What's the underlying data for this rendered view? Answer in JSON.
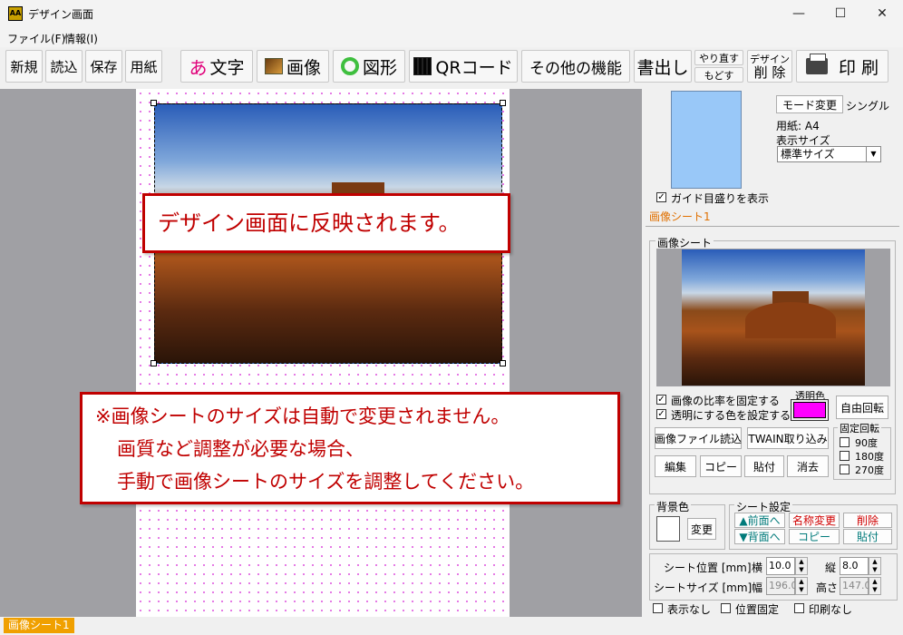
{
  "window": {
    "title": "デザイン画面",
    "app_icon": "AA",
    "minimize": "—",
    "maximize": "☐",
    "close": "✕"
  },
  "menu": {
    "file": "ファイル(F)",
    "info": "情報(I)"
  },
  "toolbar": {
    "new": "新規",
    "load": "読込",
    "save": "保存",
    "paper": "用紙",
    "text": "文字",
    "text_icon": "あ",
    "image": "画像",
    "shape": "図形",
    "qr": "QRコード",
    "other": "その他の機能",
    "export": "書出し",
    "redo": "やり直す",
    "undo": "もどす",
    "design_delete_top": "デザイン",
    "design_delete_bottom": "削 除",
    "print": "印 刷"
  },
  "callouts": {
    "reflect": "デザイン画面に反映されます。",
    "note_line1": "※画像シートのサイズは自動で変更されません。",
    "note_line2": "画質など調整が必要な場合、",
    "note_line3": "手動で画像シートのサイズを調整してください。"
  },
  "right": {
    "mode_change": "モード変更",
    "mode_value": "シングル",
    "paper_label": "用紙: A4",
    "display_size_label": "表示サイズ",
    "display_size_value": "標準サイズ",
    "show_guides": "ガイド目盛りを表示",
    "sheet_tab": "画像シート1",
    "sheet_group": "画像シート",
    "keep_ratio": "画像の比率を固定する",
    "set_transparent": "透明にする色を設定する",
    "transparent_color_label": "透明色",
    "transparent_color": "#ff00ff",
    "free_rotate": "自由回転",
    "load_image_file": "画像ファイル読込",
    "twain": "TWAIN取り込み",
    "edit": "編集",
    "copy": "コピー",
    "paste": "貼付",
    "erase": "消去",
    "fixed_rotate": "固定回転",
    "rot90": "90度",
    "rot180": "180度",
    "rot270": "270度",
    "bg_color": "背景色",
    "change": "変更",
    "sheet_settings": "シート設定",
    "front": "▲前面へ",
    "back": "▼背面へ",
    "rename": "名称変更",
    "delete": "削除",
    "copy2": "コピー",
    "paste2": "貼付",
    "sheet_pos": "シート位置 [mm]",
    "horizontal": "横",
    "vertical": "縦",
    "pos_x": "10.0",
    "pos_y": "8.0",
    "sheet_size": "シートサイズ [mm]",
    "width": "幅",
    "height": "高さ",
    "size_w": "196.0",
    "size_h": "147.0",
    "hide": "表示なし",
    "lock_pos": "位置固定",
    "no_print": "印刷なし"
  },
  "status": {
    "sheet": "画像シート1"
  }
}
